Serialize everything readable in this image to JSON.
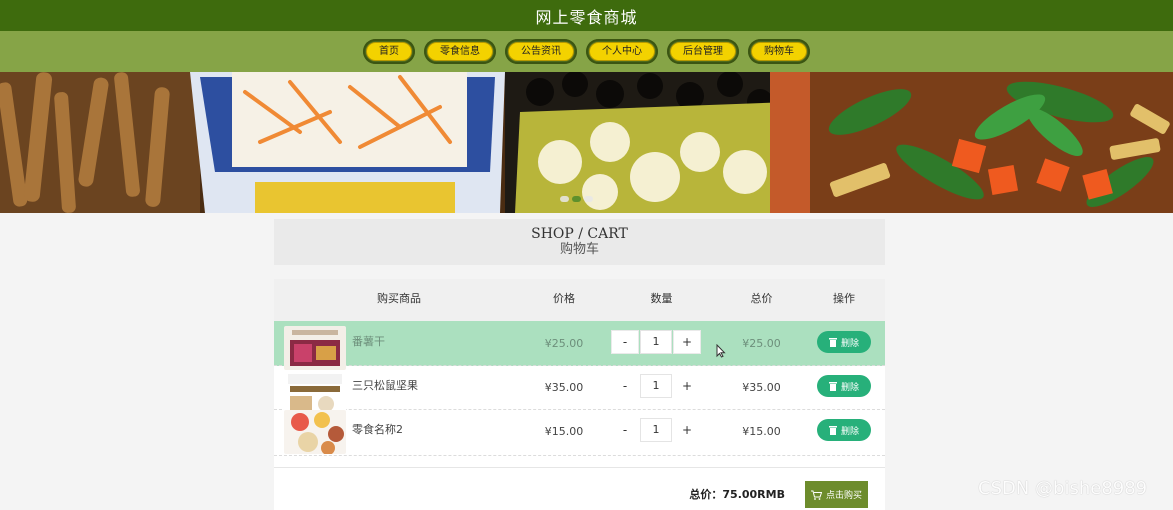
{
  "header": {
    "title": "网上零食商城"
  },
  "nav": {
    "items": [
      {
        "label": "首页"
      },
      {
        "label": "零食信息"
      },
      {
        "label": "公告资讯"
      },
      {
        "label": "个人中心"
      },
      {
        "label": "后台管理"
      },
      {
        "label": "购物车"
      }
    ]
  },
  "banner": {
    "active_slide": 2,
    "slide_count": 3
  },
  "section": {
    "title_en": "SHOP / CART",
    "title_zh": "购物车"
  },
  "cart": {
    "columns": {
      "goods": "购买商品",
      "price": "价格",
      "qty": "数量",
      "total": "总价",
      "op": "操作"
    },
    "rows": [
      {
        "name": "番薯干",
        "price": "¥25.00",
        "qty": "1",
        "total": "¥25.00",
        "minus": "-",
        "plus": "+",
        "delete": "删除"
      },
      {
        "name": "三只松鼠坚果",
        "price": "¥35.00",
        "qty": "1",
        "total": "¥35.00",
        "minus": "-",
        "plus": "+",
        "delete": "删除"
      },
      {
        "name": "零食名称2",
        "price": "¥15.00",
        "qty": "1",
        "total": "¥15.00",
        "minus": "-",
        "plus": "+",
        "delete": "删除"
      }
    ],
    "summary": "总价：75.00RMB",
    "buy_label": "点击购买"
  },
  "watermark": "CSDN @bishe8989",
  "colors": {
    "header": "#3e6b0d",
    "nav": "#86a447",
    "nav_pill": "#f3d200",
    "delete": "#27b07a",
    "buy": "#6d8c2c",
    "row_highlight": "#abe0bf"
  }
}
